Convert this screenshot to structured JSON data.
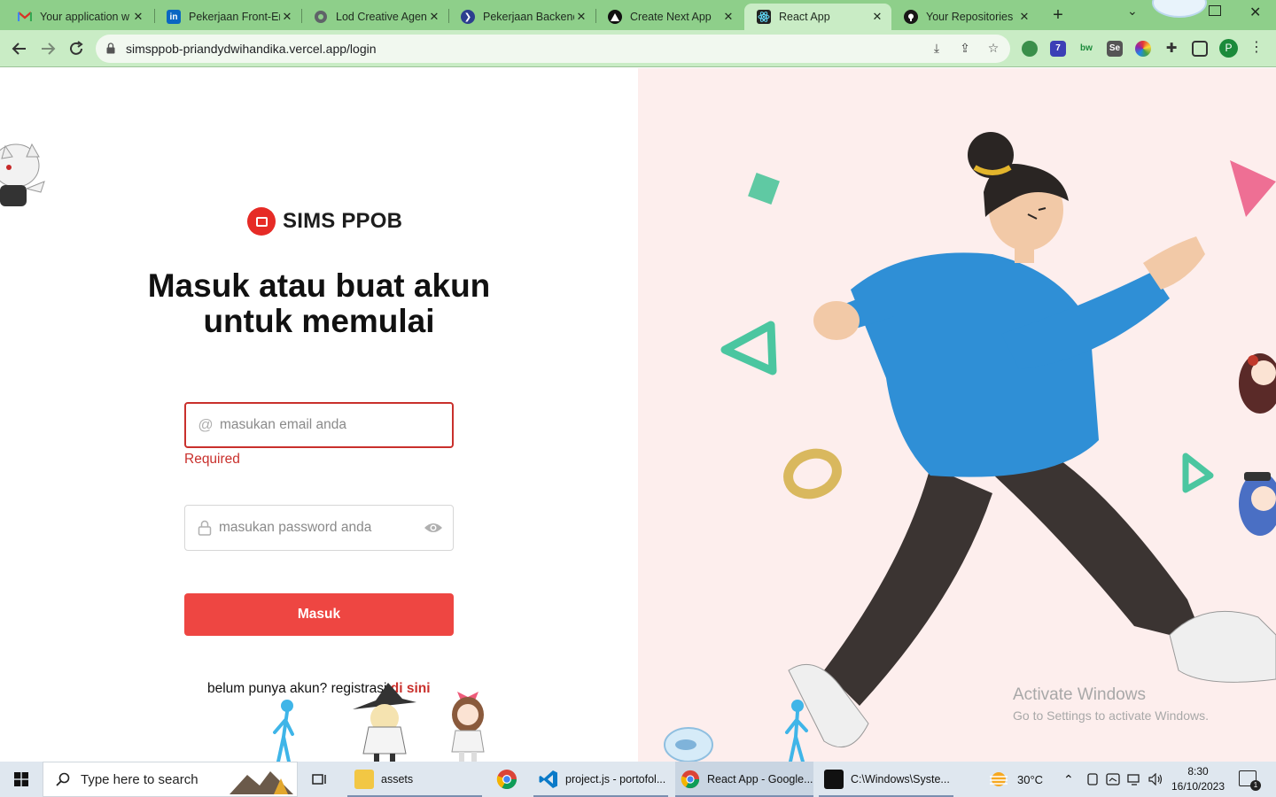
{
  "browser": {
    "tabs": [
      {
        "title": "Your application w",
        "icon": "gmail-icon",
        "color": "#d93025"
      },
      {
        "title": "Pekerjaan Front-En",
        "icon": "linkedin-icon",
        "color": "#0a66c2"
      },
      {
        "title": "Lod Creative Agen",
        "icon": "globe-icon",
        "color": "#5f6368"
      },
      {
        "title": "Pekerjaan Backend",
        "icon": "glints-icon",
        "color": "#2c3e8f"
      },
      {
        "title": "Create Next App",
        "icon": "vercel-icon",
        "color": "#111111"
      },
      {
        "title": "React App",
        "icon": "react-icon",
        "color": "#222222"
      },
      {
        "title": "Your Repositories",
        "icon": "github-icon",
        "color": "#181717"
      }
    ],
    "active_tab": "React App",
    "url": "simsppob-priandydwihandika.vercel.app/login",
    "profile_initial": "P",
    "tab_close": "✕",
    "new_tab": "+"
  },
  "login": {
    "brand_name": "SIMS PPOB",
    "headline": "Masuk atau buat akun untuk memulai",
    "email_placeholder": "masukan email anda",
    "email_error": "Required",
    "password_placeholder": "masukan password anda",
    "submit_label": "Masuk",
    "signup_prompt": "belum punya akun? registrasi",
    "signup_link": "di sini"
  },
  "watermark": {
    "title": "Activate Windows",
    "subtitle": "Go to Settings to activate Windows."
  },
  "taskbar": {
    "search_placeholder": "Type here to search",
    "apps": [
      {
        "label": "assets",
        "icon": "folder-icon"
      },
      {
        "label": "",
        "icon": "chrome-icon"
      },
      {
        "label": "project.js - portofol...",
        "icon": "vscode-icon"
      },
      {
        "label": "React App - Google...",
        "icon": "chrome-icon"
      },
      {
        "label": "C:\\Windows\\Syste...",
        "icon": "terminal-icon"
      }
    ],
    "weather": "30°C",
    "time": "8:30",
    "date": "16/10/2023",
    "notification_count": "1"
  },
  "colors": {
    "brand_red": "#e62b26",
    "button_red": "#ee4642",
    "error_red": "#c9302c",
    "illustration_bg": "#fdeeed",
    "chrome_frame": "#8ecf8a"
  }
}
